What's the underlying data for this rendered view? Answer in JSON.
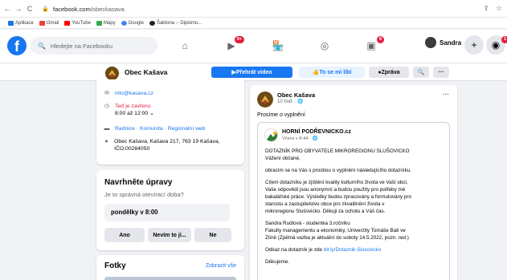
{
  "browser": {
    "url_domain": "facebook.com",
    "url_path": "/obeckasava",
    "bookmarks": [
      {
        "label": "Aplikace",
        "color": "#1a73e8"
      },
      {
        "label": "Gmail",
        "color": "#ea4335"
      },
      {
        "label": "YouTube",
        "color": "#ff0000"
      },
      {
        "label": "Mapy",
        "color": "#34a853"
      },
      {
        "label": "Google",
        "color": "#4285f4"
      },
      {
        "label": "Šablona -- Diplomo...",
        "color": "#202124"
      }
    ]
  },
  "fb_header": {
    "logo": "f",
    "search_placeholder": "Hledejte na Facebooku",
    "nav_icons": [
      "home-icon",
      "watch-icon",
      "marketplace-icon",
      "groups-icon",
      "gaming-icon"
    ],
    "watch_badge": "9+",
    "gaming_badge": "8",
    "user_name": "Sandra",
    "notif_badge": "1"
  },
  "page_header": {
    "name": "Obec Kašava",
    "play_video": "Přehrát video",
    "like": "To se mi líbí",
    "message": "Zpráva"
  },
  "about": {
    "email": "info@kasava.cz",
    "status": "Teď je zavřeno",
    "hours": "8:00 až 12:00",
    "categories": "Radnice · Komunita · Regionální web",
    "address": "Obec Kašava, Kašava 217, 763 19 Kašava, IČO.00284050"
  },
  "suggest": {
    "title": "Navrhněte úpravy",
    "question": "Je to správná otevírací doba?",
    "value": "pondělky v 8:00",
    "yes": "Ano",
    "unsure": "Nevím to ji...",
    "no": "Ne"
  },
  "photos": {
    "title": "Fotky",
    "see_all": "Zobrazit vše"
  },
  "post": {
    "author": "Obec Kašava",
    "time": "10 hod. · ",
    "text": "Prosíme o vyplnění",
    "shared_author": "HORNÍ PODŘEVNICKO.cz",
    "shared_time": "Včera v 8:44 · ",
    "lines": [
      "DOTAZNÍK PRO OBYVATELE MIKROREGIONU SLUŠOVICKO",
      "Vážení občané,",
      "obracím se na Vás s prosbou o vyplnění následujícího dotazníku.",
      "Cílem dotazníku je zjištění kvality kulturního života ve Vaší obci.",
      "Vaše odpovědi jsou anonymní a budou použity pro potřeby mé",
      "bakalářské práce. Výsledky budou zpracovány a formulovány pro",
      "starostu a zastupitelstvo obce pro zkvalitnění života v",
      "mikroregionu Slušovicko. Děkuji za ochotu a Váš čas.",
      "Sandra Rudlová - studentka 3.ročníku",
      "Fakulty managementu a ekonomiky, Univerzity Tomáše Bati ve",
      "Zlíně (Zpětná vazba je aktuální do soboty 14.5.2022, pozn. red.)",
      "Odkaz na dotazník je zde ",
      "Děkujeme."
    ],
    "link": "bit.ly/Dotaznik-Slusovicko"
  }
}
